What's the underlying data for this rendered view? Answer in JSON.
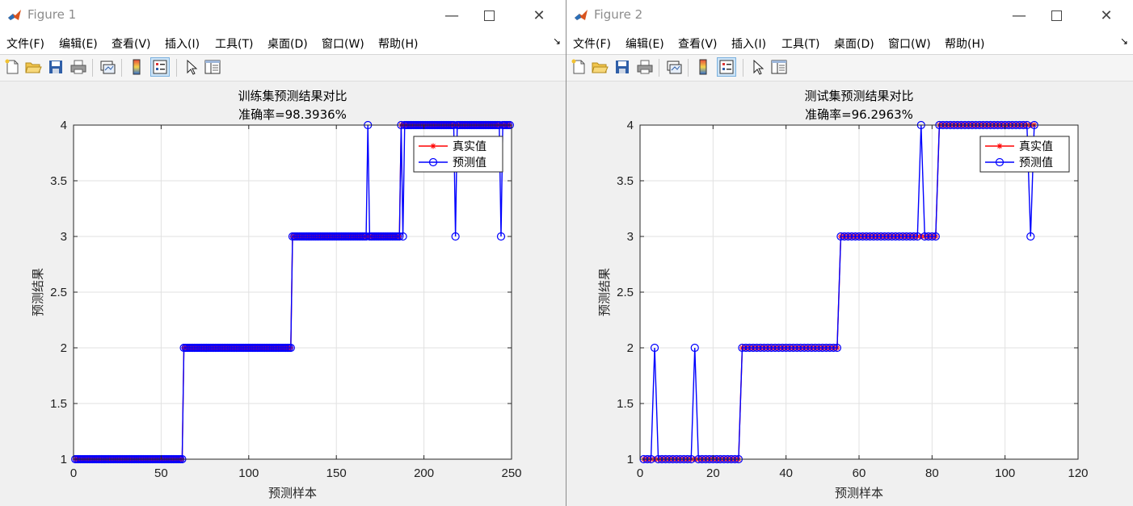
{
  "windows": [
    {
      "title": "Figure 1",
      "menu": [
        "文件(F)",
        "编辑(E)",
        "查看(V)",
        "插入(I)",
        "工具(T)",
        "桌面(D)",
        "窗口(W)",
        "帮助(H)"
      ]
    },
    {
      "title": "Figure 2",
      "menu": [
        "文件(F)",
        "编辑(E)",
        "查看(V)",
        "插入(I)",
        "工具(T)",
        "桌面(D)",
        "窗口(W)",
        "帮助(H)"
      ]
    }
  ],
  "icons": {
    "toolbar": [
      "new-figure-icon",
      "open-file-icon",
      "save-icon",
      "print-icon",
      "link-plot-icon",
      "colorbar-icon",
      "legend-icon",
      "pointer-icon",
      "property-inspector-icon"
    ]
  },
  "colors": {
    "true_series": "#ff0000",
    "pred_series": "#0000ff",
    "grid": "#e1e1e1"
  },
  "chart_data": [
    {
      "type": "line",
      "title": "训练集预测结果对比",
      "subtitle": "准确率=98.3936%",
      "xlabel": "预测样本",
      "ylabel": "预测结果",
      "xlim": [
        0,
        250
      ],
      "ylim": [
        1,
        4
      ],
      "xticks": [
        0,
        50,
        100,
        150,
        200,
        250
      ],
      "yticks": [
        1,
        1.5,
        2,
        2.5,
        3,
        3.5,
        4
      ],
      "grid": true,
      "legend_position": "top-right",
      "segments": [
        {
          "from": 1,
          "to": 62,
          "value": 1
        },
        {
          "from": 63,
          "to": 124,
          "value": 2
        },
        {
          "from": 125,
          "to": 186,
          "value": 3
        },
        {
          "from": 187,
          "to": 249,
          "value": 4
        }
      ],
      "mispredictions": [
        {
          "x": 168,
          "value": 4
        },
        {
          "x": 188,
          "value": 3
        },
        {
          "x": 218,
          "value": 3
        },
        {
          "x": 244,
          "value": 3
        }
      ],
      "series": [
        {
          "name": "真实值",
          "marker": "*",
          "color": "#ff0000"
        },
        {
          "name": "预测值",
          "marker": "o",
          "color": "#0000ff"
        }
      ]
    },
    {
      "type": "line",
      "title": "测试集预测结果对比",
      "subtitle": "准确率=96.2963%",
      "xlabel": "预测样本",
      "ylabel": "预测结果",
      "xlim": [
        0,
        120
      ],
      "ylim": [
        1,
        4
      ],
      "xticks": [
        0,
        20,
        40,
        60,
        80,
        100,
        120
      ],
      "yticks": [
        1,
        1.5,
        2,
        2.5,
        3,
        3.5,
        4
      ],
      "grid": true,
      "legend_position": "top-right",
      "segments": [
        {
          "from": 1,
          "to": 27,
          "value": 1
        },
        {
          "from": 28,
          "to": 54,
          "value": 2
        },
        {
          "from": 55,
          "to": 81,
          "value": 3
        },
        {
          "from": 82,
          "to": 108,
          "value": 4
        }
      ],
      "mispredictions": [
        {
          "x": 4,
          "value": 2
        },
        {
          "x": 15,
          "value": 2
        },
        {
          "x": 77,
          "value": 4
        },
        {
          "x": 107,
          "value": 3
        }
      ],
      "series": [
        {
          "name": "真实值",
          "marker": "*",
          "color": "#ff0000"
        },
        {
          "name": "预测值",
          "marker": "o",
          "color": "#0000ff"
        }
      ]
    }
  ]
}
